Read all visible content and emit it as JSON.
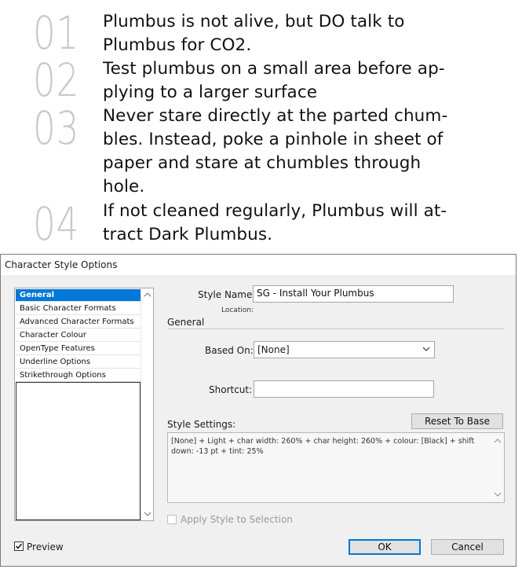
{
  "document": {
    "items": [
      {
        "number": "01",
        "lines": [
          "Plumbus is not alive, but DO talk to",
          "Plumbus for CO2."
        ]
      },
      {
        "number": "02",
        "lines": [
          "Test plumbus on a small area before ap-",
          "plying to a larger surface"
        ]
      },
      {
        "number": "03",
        "lines": [
          "Never stare directly at the parted chum-",
          "bles. Instead, poke a pinhole in sheet of",
          "paper and stare at chumbles through",
          "hole."
        ]
      },
      {
        "number": "04",
        "lines": [
          "If not cleaned regularly, Plumbus will at-",
          "tract Dark Plumbus."
        ]
      }
    ]
  },
  "dialog": {
    "title": "Character Style Options",
    "categories": [
      "General",
      "Basic Character Formats",
      "Advanced Character Formats",
      "Character Colour",
      "OpenType Features",
      "Underline Options",
      "Strikethrough Options"
    ],
    "selected_category": "General",
    "style_name_label": "Style Name:",
    "style_name_value": "SG - Install Your Plumbus",
    "location_label": "Location:",
    "section_heading": "General",
    "based_on_label": "Based On:",
    "based_on_value": "[None]",
    "shortcut_label": "Shortcut:",
    "shortcut_value": "",
    "style_settings_label": "Style Settings:",
    "reset_button": "Reset To Base",
    "style_settings_text": "[None] + Light + char width: 260% + char height: 260% + colour: [Black] + shift down: -13 pt + tint: 25%",
    "apply_to_selection_label": "Apply Style to Selection",
    "apply_to_selection_checked": false,
    "preview_label": "Preview",
    "preview_checked": true,
    "ok_button": "OK",
    "cancel_button": "Cancel"
  },
  "colors": {
    "accent": "#0078d7",
    "number_gray": "#c9c9c9",
    "dialog_bg": "#f0f0f0"
  }
}
